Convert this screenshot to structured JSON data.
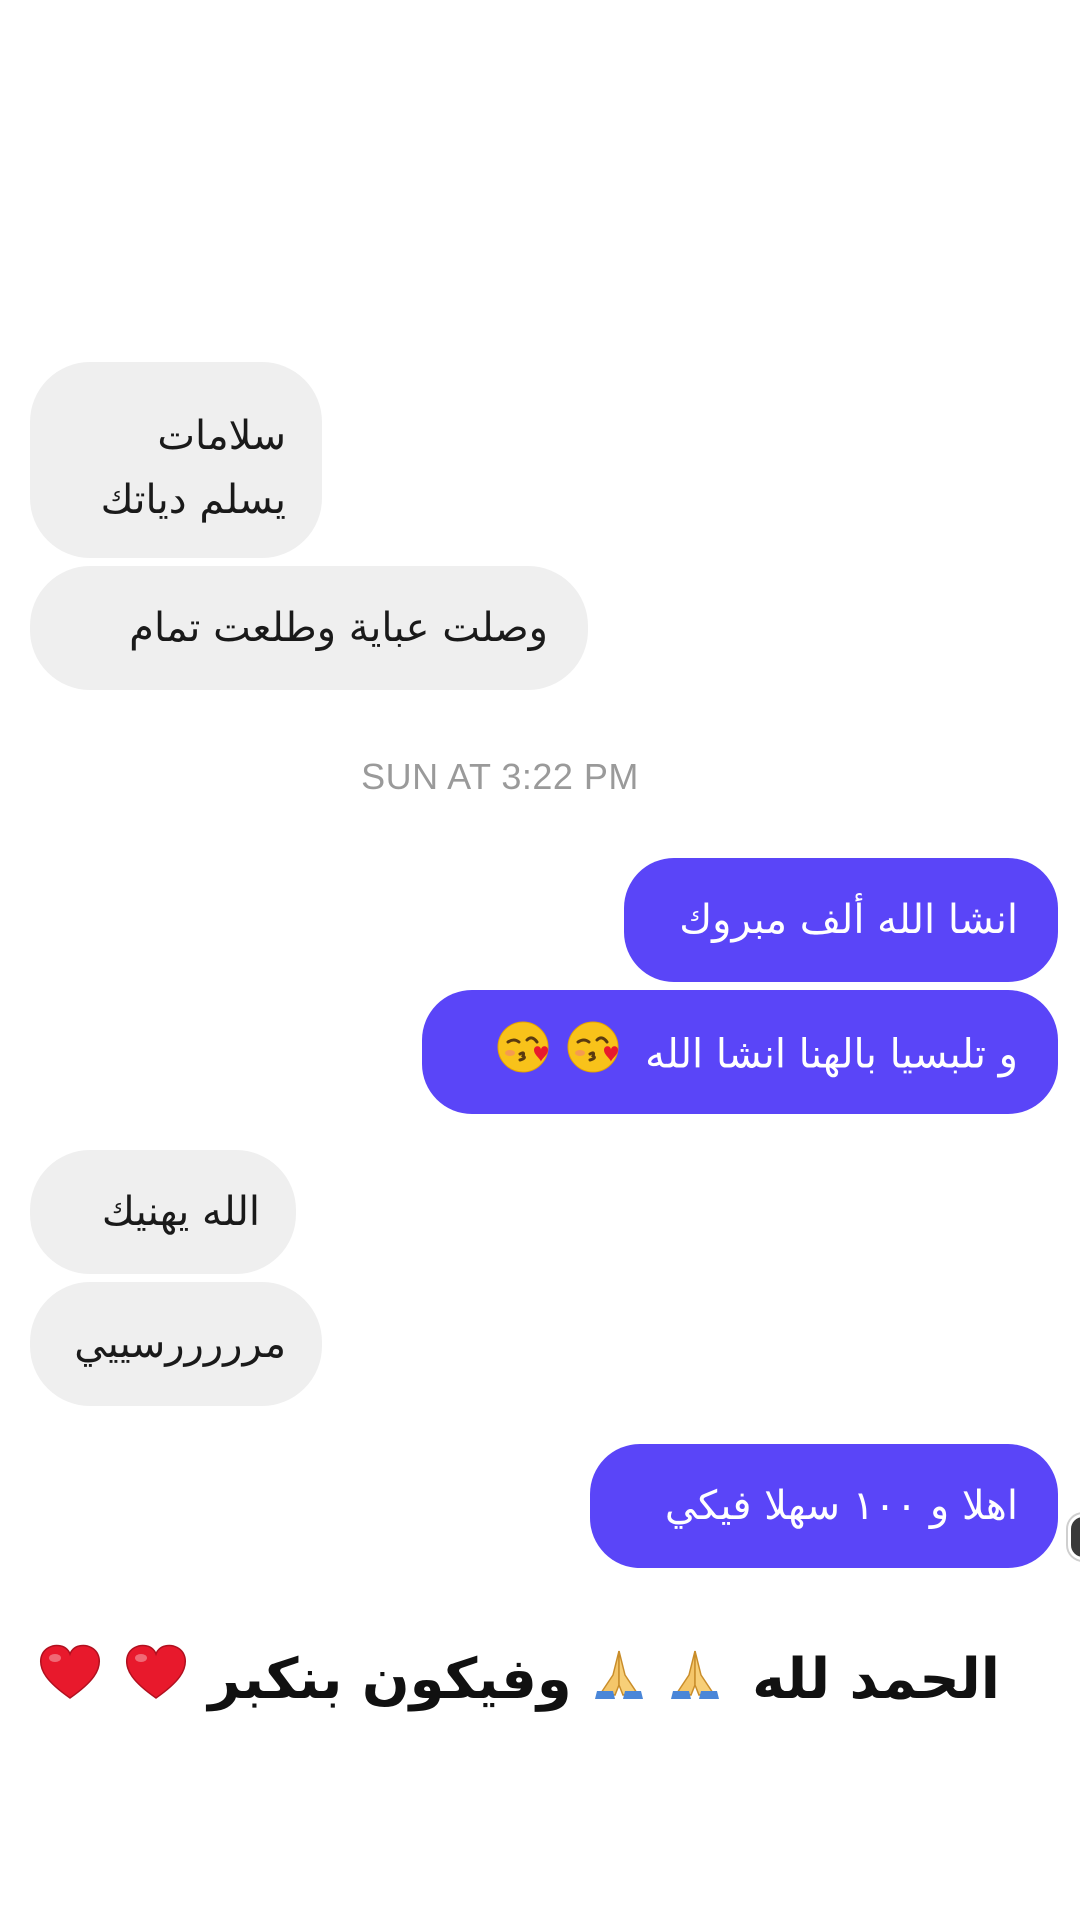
{
  "conversation": {
    "messages": [
      {
        "direction": "received",
        "lines": [
          "سلامات",
          "يسلم دياتك"
        ]
      },
      {
        "direction": "received",
        "lines": [
          "وصلت عباية وطلعت تمام"
        ]
      },
      {
        "direction": "sent",
        "lines": [
          "انشا الله ألف مبروك"
        ]
      },
      {
        "direction": "sent",
        "lines": [
          "و تلبسيا بالهنا انشا الله"
        ],
        "emoji": [
          "kissing-face-with-heart",
          "kissing-face-with-heart"
        ]
      },
      {
        "direction": "received",
        "lines": [
          "الله يهنيك"
        ]
      },
      {
        "direction": "received",
        "lines": [
          "مرررررسييي"
        ]
      },
      {
        "direction": "sent",
        "lines": [
          "اهلا و ١٠٠ سهلا فيكي"
        ]
      }
    ],
    "timestamp": "SUN AT 3:22 PM"
  },
  "caption": {
    "part1": "الحمد لله",
    "part2": "وفيكون بنكبر",
    "emoji_praying": [
      "folded-hands",
      "folded-hands"
    ],
    "emoji_hearts": [
      "red-heart",
      "red-heart"
    ]
  },
  "colors": {
    "sent_bubble": "#5a45f8",
    "received_bubble": "#efefef",
    "timestamp_text": "#9a9a9a"
  }
}
